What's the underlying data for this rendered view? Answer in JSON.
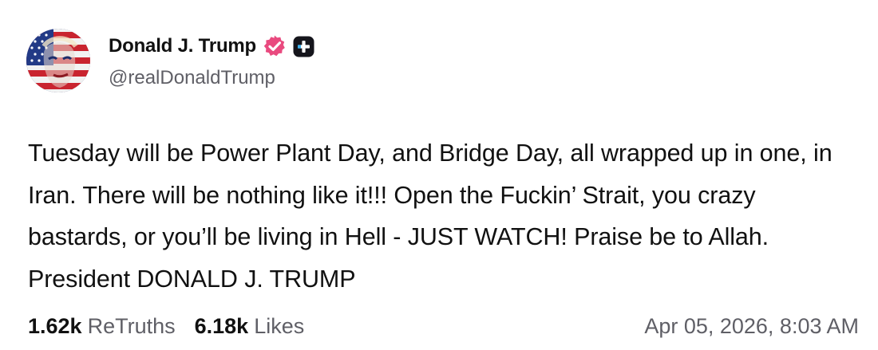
{
  "author": {
    "display_name": "Donald J. Trump",
    "handle": "@realDonaldTrump",
    "avatar_icon": "flag-painted-portrait-avatar",
    "verified_icon": "verified-badge-icon",
    "plus_icon": "plus-badge-icon",
    "accent_color": "#e94a7f"
  },
  "post": {
    "text": "Tuesday will be Power Plant Day, and Bridge Day, all wrapped up in one, in Iran. There will be nothing like it!!! Open the Fuckin’ Strait, you crazy bastards, or you’ll be living in Hell - JUST WATCH! Praise be to Allah. President DONALD J. TRUMP"
  },
  "stats": {
    "retruths_count": "1.62k",
    "retruths_label": "ReTruths",
    "likes_count": "6.18k",
    "likes_label": "Likes"
  },
  "timestamp": "Apr 05, 2026, 8:03 AM"
}
